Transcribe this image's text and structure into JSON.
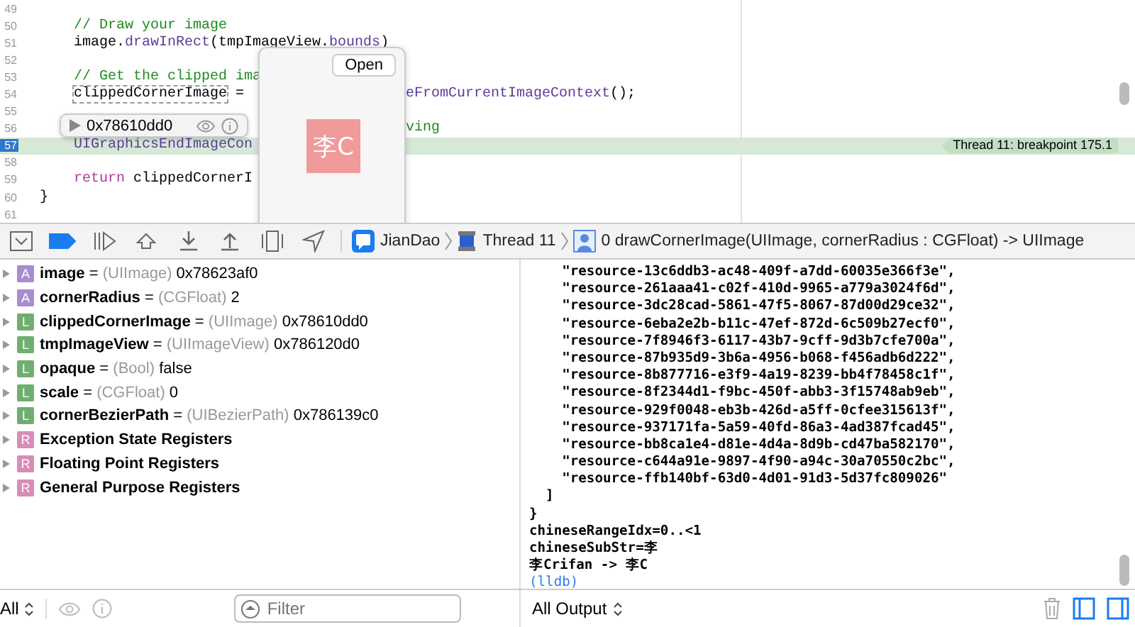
{
  "editor": {
    "lines": [
      {
        "number": "49",
        "current": false
      },
      {
        "number": "50",
        "indented": true,
        "segments": [
          {
            "text": "// Draw your image",
            "kind": "comment"
          }
        ],
        "current": false
      },
      {
        "number": "51",
        "indented": true,
        "segments": [
          {
            "text": "image.",
            "kind": "plain"
          },
          {
            "text": "drawInRect",
            "kind": "method"
          },
          {
            "text": "(tmpImageView.",
            "kind": "plain"
          },
          {
            "text": "bounds",
            "kind": "method"
          },
          {
            "text": ")",
            "kind": "plain"
          }
        ],
        "current": false
      },
      {
        "number": "52",
        "current": false
      },
      {
        "number": "53",
        "indented": true,
        "segments": [
          {
            "text": "// Get the clipped ima",
            "kind": "comment"
          }
        ],
        "current": false
      },
      {
        "number": "54",
        "indented": true,
        "segments": [
          {
            "text": "clippedCornerImage",
            "kind": "highlight"
          },
          {
            "text": " =",
            "kind": "plain"
          }
        ],
        "after": [
          {
            "text": "eFromCurrentImageContext",
            "kind": "method"
          },
          {
            "text": "();",
            "kind": "plain"
          }
        ],
        "current": false
      },
      {
        "number": "55",
        "current": false
      },
      {
        "number": "56",
        "after": [
          {
            "text": "ving",
            "kind": "comment"
          }
        ],
        "current": false
      },
      {
        "number": "57",
        "indented": true,
        "segments": [
          {
            "text": "UIGraphicsEndImageCon",
            "kind": "method"
          }
        ],
        "current": true
      },
      {
        "number": "58",
        "current": false
      },
      {
        "number": "59",
        "indented": true,
        "segments": [
          {
            "text": "return",
            "kind": "keyword"
          },
          {
            "text": " clippedCornerI",
            "kind": "plain"
          }
        ],
        "current": false
      },
      {
        "number": "60",
        "segments": [
          {
            "text": "}",
            "kind": "plain"
          }
        ],
        "current": false
      },
      {
        "number": "61",
        "current": false
      }
    ],
    "breakpoint_label": "Thread 11: breakpoint 175.1",
    "value_tip": {
      "value": "0x78610dd0"
    },
    "quick_look": {
      "button": "Open",
      "image_text": "李C"
    }
  },
  "debug_bar": {
    "buttons": [
      {
        "kind": "panel"
      },
      {
        "kind": "breakpoints",
        "on": true
      },
      {
        "kind": "continue"
      },
      {
        "kind": "step-over"
      },
      {
        "kind": "step-in"
      },
      {
        "kind": "step-out"
      },
      {
        "kind": "view-debugger"
      },
      {
        "kind": "location"
      }
    ],
    "breadcrumbs": [
      {
        "kind": "app",
        "label": "JianDao"
      },
      {
        "kind": "thread",
        "label": "Thread 11"
      },
      {
        "kind": "frame",
        "label": "0 drawCornerImage(UIImage, cornerRadius : CGFloat) -> UIImage"
      }
    ]
  },
  "variables": [
    {
      "kind": "argument",
      "badge": "A",
      "name": "image",
      "separator": "=",
      "type": "(UIImage)",
      "value": "0x78623af0"
    },
    {
      "kind": "argument",
      "badge": "A",
      "name": "cornerRadius",
      "separator": "=",
      "type": "(CGFloat)",
      "value": "2"
    },
    {
      "kind": "local",
      "badge": "L",
      "name": "clippedCornerImage",
      "separator": "=",
      "type": "(UIImage)",
      "value": "0x78610dd0"
    },
    {
      "kind": "local",
      "badge": "L",
      "name": "tmpImageView",
      "separator": "=",
      "type": "(UIImageView)",
      "value": "0x786120d0"
    },
    {
      "kind": "local",
      "badge": "L",
      "name": "opaque",
      "separator": "=",
      "type": "(Bool)",
      "value": "false"
    },
    {
      "kind": "local",
      "badge": "L",
      "name": "scale",
      "separator": "=",
      "type": "(CGFloat)",
      "value": "0"
    },
    {
      "kind": "local",
      "badge": "L",
      "name": "cornerBezierPath",
      "separator": "=",
      "type": "(UIBezierPath)",
      "value": "0x786139c0"
    },
    {
      "kind": "register",
      "badge": "R",
      "name": "Exception State Registers"
    },
    {
      "kind": "register",
      "badge": "R",
      "name": "Floating Point Registers"
    },
    {
      "kind": "register",
      "badge": "R",
      "name": "General Purpose Registers"
    }
  ],
  "console": {
    "lines": [
      {
        "kind": "output",
        "text": "\"resource-13c6ddb3-ac48-409f-a7dd-60035e366f3e\","
      },
      {
        "kind": "output",
        "text": "\"resource-261aaa41-c02f-410d-9965-a779a3024f6d\","
      },
      {
        "kind": "output",
        "text": "\"resource-3dc28cad-5861-47f5-8067-87d00d29ce32\","
      },
      {
        "kind": "output",
        "text": "\"resource-6eba2e2b-b11c-47ef-872d-6c509b27ecf0\","
      },
      {
        "kind": "output",
        "text": "\"resource-7f8946f3-6117-43b7-9cff-9d3b7cfe700a\","
      },
      {
        "kind": "output",
        "text": "\"resource-87b935d9-3b6a-4956-b068-f456adb6d222\","
      },
      {
        "kind": "output",
        "text": "\"resource-8b877716-e3f9-4a19-8239-bb4f78458c1f\","
      },
      {
        "kind": "output",
        "text": "\"resource-8f2344d1-f9bc-450f-abb3-3f15748ab9eb\","
      },
      {
        "kind": "output",
        "text": "\"resource-929f0048-eb3b-426d-a5ff-0cfee315613f\","
      },
      {
        "kind": "output",
        "text": "\"resource-937171fa-5a59-40fd-86a3-4ad387fcad45\","
      },
      {
        "kind": "output",
        "text": "\"resource-bb8ca1e4-d81e-4d4a-8d9b-cd47ba582170\","
      },
      {
        "kind": "output",
        "text": "\"resource-c644a91e-9897-4f90-a94c-30a70550c2bc\","
      },
      {
        "kind": "output",
        "text": "\"resource-ffb140bf-63d0-4d01-91d3-5d37fc809026\""
      },
      {
        "kind": "close-bracket",
        "text": "]"
      },
      {
        "kind": "output",
        "text": "}"
      },
      {
        "kind": "output",
        "text": "chineseRangeIdx=0..<1"
      },
      {
        "kind": "output",
        "text": "chineseSubStr=李"
      },
      {
        "kind": "output",
        "text": "李Crifan -> 李C"
      },
      {
        "kind": "prompt",
        "text": "(lldb)"
      }
    ]
  },
  "bottom_bar": {
    "scope": "All",
    "filter": {
      "placeholder": "Filter"
    },
    "output_scope": "All Output"
  }
}
